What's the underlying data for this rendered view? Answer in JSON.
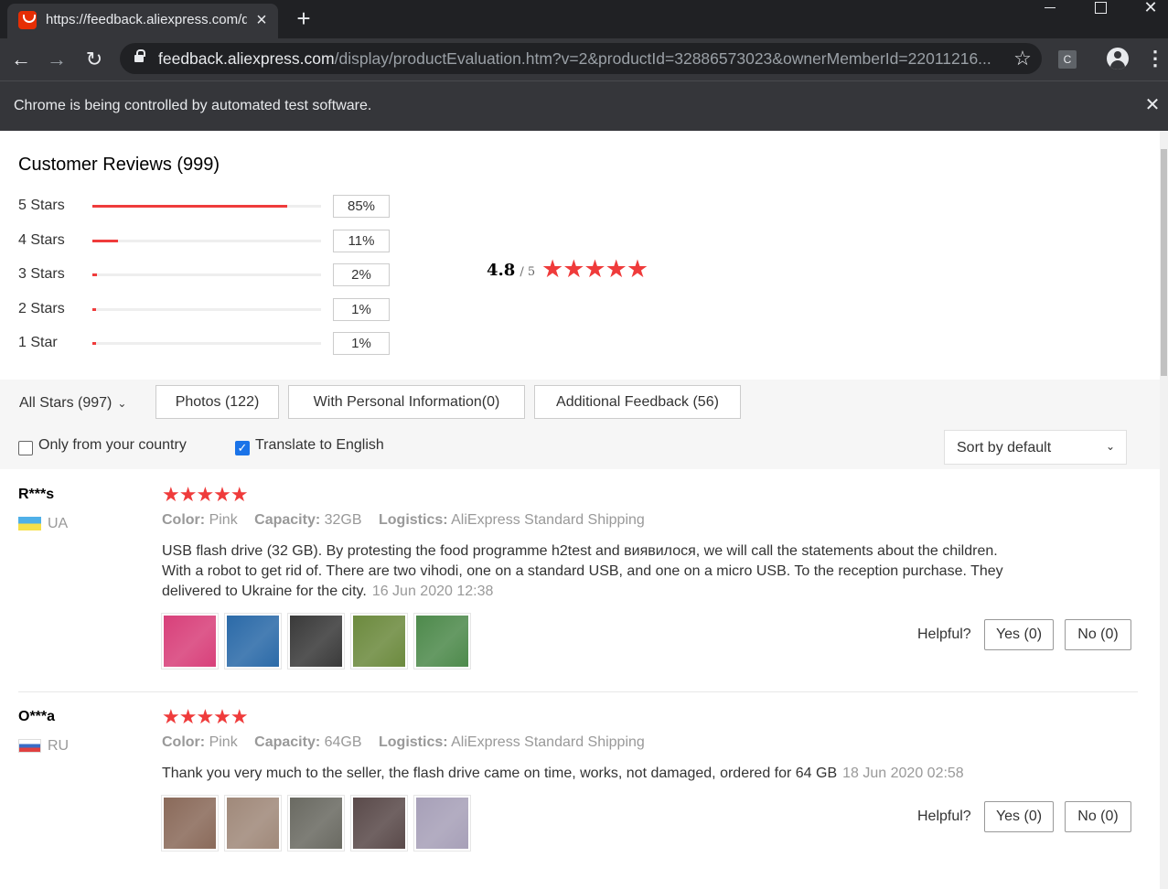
{
  "browser": {
    "tab_title": "https://feedback.aliexpress.com/displ",
    "url_host": "feedback.aliexpress.com",
    "url_path": "/display/productEvaluation.htm?v=2&productId=32886573023&ownerMemberId=22011216...",
    "ext_label": "C",
    "infobar_text": "Chrome is being controlled by automated test software."
  },
  "summary": {
    "title": "Customer Reviews (999)",
    "average": "4.8",
    "out_of": "/ 5",
    "stars_glyph": "★★★★★",
    "star_rows": [
      {
        "label": "5 Stars",
        "pct": "85%",
        "value": 85
      },
      {
        "label": "4 Stars",
        "pct": "11%",
        "value": 11
      },
      {
        "label": "3 Stars",
        "pct": "2%",
        "value": 2
      },
      {
        "label": "2 Stars",
        "pct": "1%",
        "value": 1
      },
      {
        "label": "1 Star",
        "pct": "1%",
        "value": 1
      }
    ]
  },
  "filters": {
    "all_stars": "All Stars (997)",
    "photos": "Photos (122)",
    "personal_info": "With Personal Information(0)",
    "additional": "Additional Feedback (56)",
    "only_country": "Only from your country",
    "only_country_checked": false,
    "translate": "Translate to English",
    "translate_checked": true,
    "sort": "Sort by default"
  },
  "reviews": [
    {
      "name": "R***s",
      "country": "UA",
      "stars": "★★★★★",
      "color_key": "Color:",
      "color": "Pink",
      "capacity_key": "Capacity:",
      "capacity": "32GB",
      "logistics_key": "Logistics:",
      "logistics": "AliExpress Standard Shipping",
      "text": "USB flash drive (32 GB). By protesting the food programme h2test and виявилося, we will call the statements about the children. With a robot to get rid of. There are two vihodi, one on a standard USB, and one on a micro USB. To the reception purchase. They delivered to Ukraine for the city.",
      "date": "16 Jun 2020 12:38",
      "photos": [
        "#d8407a",
        "#2b6aa8",
        "#3a3a3a",
        "#6c8a3e",
        "#4e8a4c"
      ],
      "helpful": "Helpful?",
      "yes": "Yes (0)",
      "no": "No (0)"
    },
    {
      "name": "O***a",
      "country": "RU",
      "stars": "★★★★★",
      "color_key": "Color:",
      "color": "Pink",
      "capacity_key": "Capacity:",
      "capacity": "64GB",
      "logistics_key": "Logistics:",
      "logistics": "AliExpress Standard Shipping",
      "text": "Thank you very much to the seller, the flash drive came on time, works, not damaged, ordered for 64 GB",
      "date": "18 Jun 2020 02:58",
      "photos": [
        "#8a6a5a",
        "#a0897a",
        "#6a6a62",
        "#5a4a4a",
        "#a7a0b8"
      ],
      "helpful": "Helpful?",
      "yes": "Yes (0)",
      "no": "No (0)"
    }
  ]
}
